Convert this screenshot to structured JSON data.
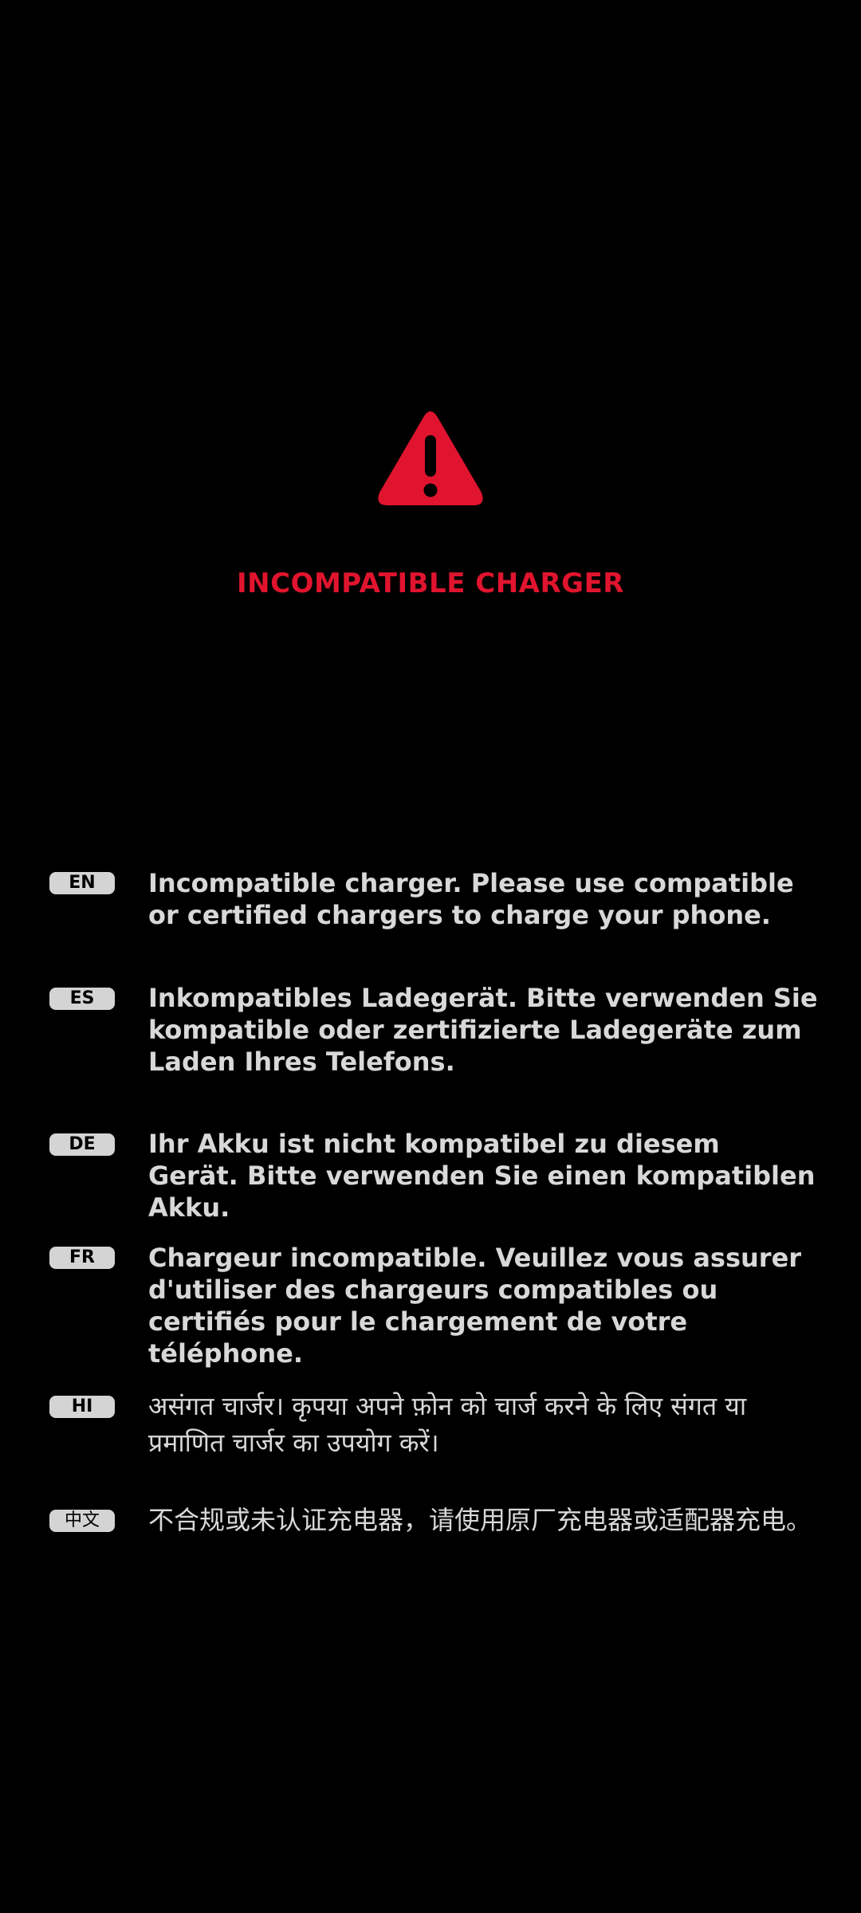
{
  "alert": {
    "icon": "warning-triangle-icon",
    "title": "INCOMPATIBLE CHARGER",
    "accent_color": "#e0142e"
  },
  "messages": [
    {
      "lang": "EN",
      "text": "Incompatible charger. Please use compatible or certified chargers to charge your phone."
    },
    {
      "lang": "ES",
      "text": "Inkompatibles Ladegerät. Bitte verwenden Sie kompatible oder zertifizierte Ladegeräte zum Laden Ihres Telefons."
    },
    {
      "lang": "DE",
      "text": "Ihr Akku ist nicht kompatibel zu diesem Gerät. Bitte verwenden Sie einen kompatiblen Akku."
    },
    {
      "lang": "FR",
      "text": "Chargeur incompatible. Veuillez vous assurer d'utiliser des chargeurs compatibles ou certifiés pour le chargement de votre téléphone."
    },
    {
      "lang": "HI",
      "text": "असंगत चार्जर। कृपया अपने फ़ोन को चार्ज करने के लिए संगत या प्रमाणित चार्जर का उपयोग करें।"
    },
    {
      "lang": "中文",
      "text": "不合规或未认证充电器，请使用原厂充电器或适配器充电。"
    }
  ]
}
